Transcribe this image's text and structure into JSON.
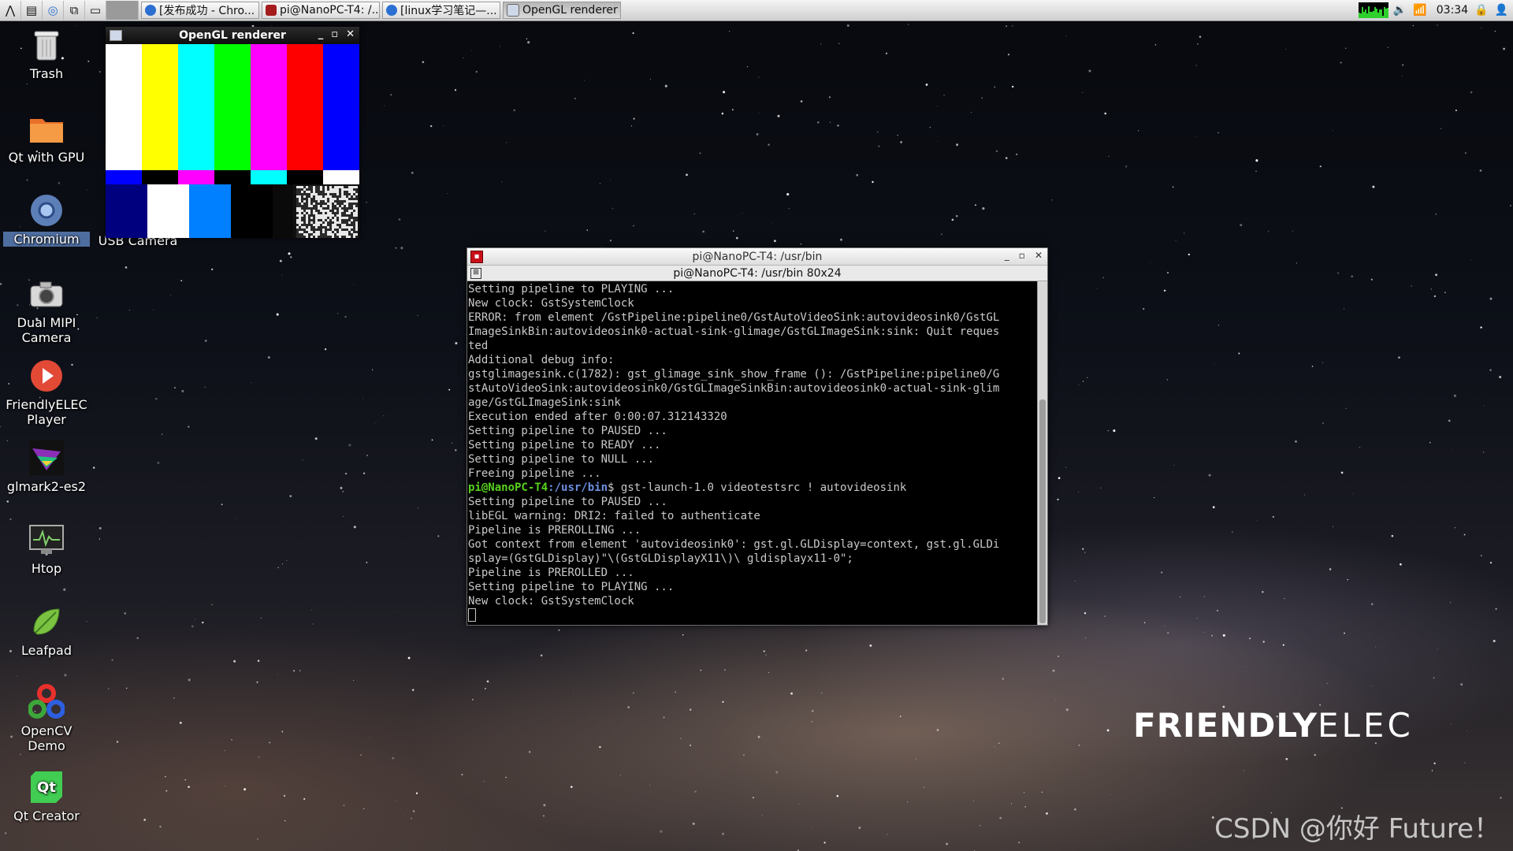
{
  "taskbar": {
    "tasks": [
      {
        "label": "[发布成功 - Chro..."
      },
      {
        "label": "pi@NanoPC-T4: /..."
      },
      {
        "label": "[linux学习笔记—..."
      },
      {
        "label": "OpenGL renderer"
      }
    ],
    "clock": "03:34"
  },
  "desktop": {
    "icons": [
      {
        "label": "Trash"
      },
      {
        "label": "Qt with GPU"
      },
      {
        "label": "Chromium"
      },
      {
        "label": "Dual MIPI Camera"
      },
      {
        "label": "FriendlyELEC Player"
      },
      {
        "label": "glmark2-es2"
      },
      {
        "label": "Htop"
      },
      {
        "label": "Leafpad"
      },
      {
        "label": "OpenCV Demo"
      },
      {
        "label": "Qt Creator"
      }
    ],
    "partial_icon_label": "USB Camera"
  },
  "gl_window": {
    "title": "OpenGL renderer",
    "colors": {
      "top": [
        "#ffffff",
        "#ffff00",
        "#00ffff",
        "#00ff00",
        "#ff00ff",
        "#ff0000",
        "#0000ff"
      ],
      "middle": [
        "#0000ff",
        "#000000",
        "#ff00ff",
        "#000000",
        "#00ffff",
        "#000000",
        "#ffffff"
      ],
      "bottom": [
        "#00007f",
        "#ffffff",
        "#0080ff",
        "#000000",
        "#0a0a0a",
        "#111111"
      ]
    }
  },
  "terminal": {
    "title": "pi@NanoPC-T4: /usr/bin",
    "subtitle": "pi@NanoPC-T4: /usr/bin 80x24",
    "lines": [
      "Setting pipeline to PLAYING ...",
      "New clock: GstSystemClock",
      "ERROR: from element /GstPipeline:pipeline0/GstAutoVideoSink:autovideosink0/GstGL",
      "ImageSinkBin:autovideosink0-actual-sink-glimage/GstGLImageSink:sink: Quit reques",
      "ted",
      "Additional debug info:",
      "gstglimagesink.c(1782): gst_glimage_sink_show_frame (): /GstPipeline:pipeline0/G",
      "stAutoVideoSink:autovideosink0/GstGLImageSinkBin:autovideosink0-actual-sink-glim",
      "age/GstGLImageSink:sink",
      "Execution ended after 0:00:07.312143320",
      "Setting pipeline to PAUSED ...",
      "Setting pipeline to READY ...",
      "Setting pipeline to NULL ...",
      "Freeing pipeline ..."
    ],
    "prompt_user": "pi@NanoPC-T4",
    "prompt_path": ":/usr/bin",
    "prompt_cmd": "$ gst-launch-1.0 videotestsrc ! autovideosink",
    "lines_after": [
      "Setting pipeline to PAUSED ...",
      "libEGL warning: DRI2: failed to authenticate",
      "Pipeline is PREROLLING ...",
      "Got context from element 'autovideosink0': gst.gl.GLDisplay=context, gst.gl.GLDi",
      "splay=(GstGLDisplay)\"\\(GstGLDisplayX11\\)\\ gldisplayx11-0\";",
      "Pipeline is PREROLLED ...",
      "Setting pipeline to PLAYING ...",
      "New clock: GstSystemClock"
    ]
  },
  "brand": {
    "bold": "FRIENDLY",
    "thin": "ELEC"
  },
  "watermark": "CSDN @你好  Future！"
}
